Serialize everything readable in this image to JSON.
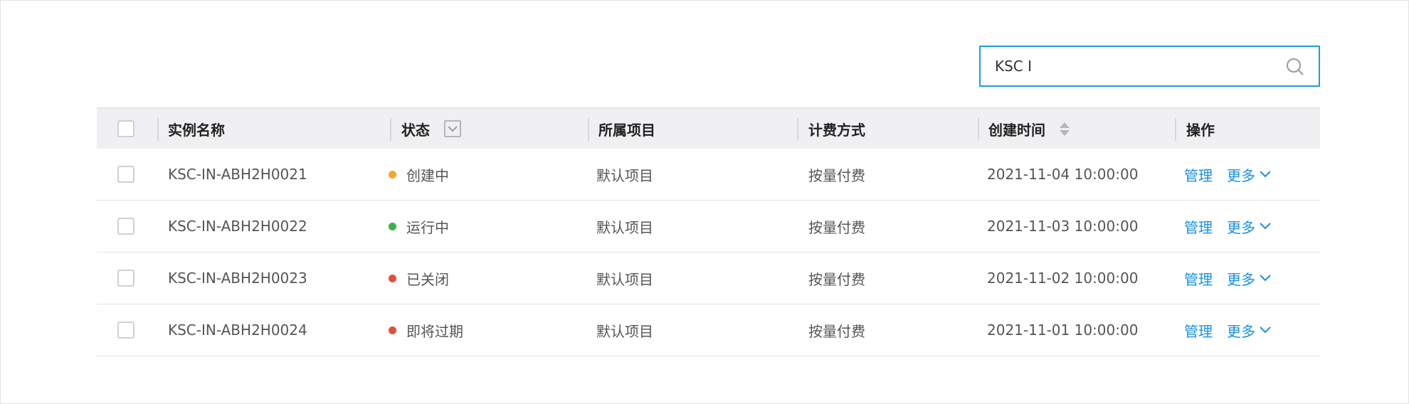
{
  "search": {
    "value": "KSC I",
    "placeholder": ""
  },
  "colors": {
    "accent": "#1a8fe0",
    "status_creating": "#f5a623",
    "status_running": "#3bb14a",
    "status_closed": "#e84c3d",
    "status_expiring": "#e84c3d"
  },
  "table": {
    "headers": {
      "name": "实例名称",
      "status": "状态",
      "project": "所属项目",
      "billing": "计费方式",
      "created": "创建时间",
      "actions": "操作"
    },
    "rows": [
      {
        "name": "KSC-IN-ABH2H0021",
        "status": "创建中",
        "status_color": "#f5a623",
        "project": "默认项目",
        "billing": "按量付费",
        "created": "2021-11-04 10:00:00",
        "manage": "管理",
        "more": "更多"
      },
      {
        "name": "KSC-IN-ABH2H0022",
        "status": "运行中",
        "status_color": "#3bb14a",
        "project": "默认项目",
        "billing": "按量付费",
        "created": "2021-11-03 10:00:00",
        "manage": "管理",
        "more": "更多"
      },
      {
        "name": "KSC-IN-ABH2H0023",
        "status": "已关闭",
        "status_color": "#e84c3d",
        "project": "默认项目",
        "billing": "按量付费",
        "created": "2021-11-02 10:00:00",
        "manage": "管理",
        "more": "更多"
      },
      {
        "name": "KSC-IN-ABH2H0024",
        "status": "即将过期",
        "status_color": "#e84c3d",
        "project": "默认项目",
        "billing": "按量付费",
        "created": "2021-11-01 10:00:00",
        "manage": "管理",
        "more": "更多"
      }
    ]
  }
}
